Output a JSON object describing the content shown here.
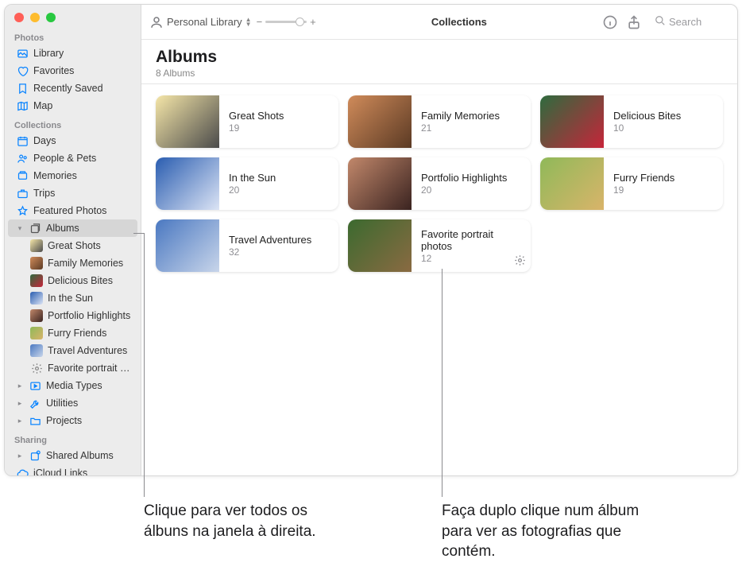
{
  "toolbar": {
    "library_label": "Personal Library",
    "center_title": "Collections",
    "search_placeholder": "Search"
  },
  "sidebar": {
    "section_photos": "Photos",
    "section_collections": "Collections",
    "section_sharing": "Sharing",
    "items": {
      "library": "Library",
      "favorites": "Favorites",
      "recently_saved": "Recently Saved",
      "map": "Map",
      "days": "Days",
      "people_pets": "People & Pets",
      "memories": "Memories",
      "trips": "Trips",
      "featured": "Featured Photos",
      "albums": "Albums",
      "media_types": "Media Types",
      "utilities": "Utilities",
      "projects": "Projects",
      "shared_albums": "Shared Albums",
      "icloud_links": "iCloud Links"
    },
    "album_children": [
      "Great Shots",
      "Family Memories",
      "Delicious Bites",
      "In the Sun",
      "Portfolio Highlights",
      "Furry Friends",
      "Travel Adventures",
      "Favorite portrait photos"
    ]
  },
  "header": {
    "title": "Albums",
    "subtitle": "8 Albums"
  },
  "albums": [
    {
      "name": "Great Shots",
      "count": "19"
    },
    {
      "name": "Family Memories",
      "count": "21"
    },
    {
      "name": "Delicious Bites",
      "count": "10"
    },
    {
      "name": "In the Sun",
      "count": "20"
    },
    {
      "name": "Portfolio Highlights",
      "count": "20"
    },
    {
      "name": "Furry Friends",
      "count": "19"
    },
    {
      "name": "Travel Adventures",
      "count": "32"
    },
    {
      "name": "Favorite portrait photos",
      "count": "12"
    }
  ],
  "callouts": {
    "left": "Clique para ver todos os álbuns na janela à direita.",
    "right": "Faça duplo clique num álbum para ver as fotografias que contém."
  }
}
